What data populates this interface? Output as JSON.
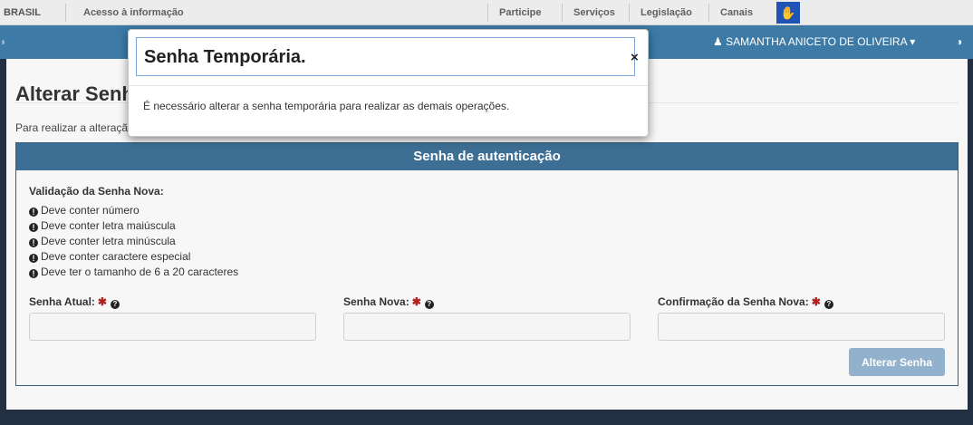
{
  "gov_bar": {
    "brand": "BRASIL",
    "access_info": "Acesso à informação",
    "links": [
      "Participe",
      "Serviços",
      "Legislação",
      "Canais"
    ]
  },
  "navbar": {
    "user_name": "SAMANTHA ANICETO DE OLIVEIRA",
    "icons": [
      "user-icon",
      "caret-down-icon",
      "contrast-icon",
      "accessibility-icon"
    ]
  },
  "page": {
    "title": "Alterar Senha",
    "intro": "Para realizar a alteração"
  },
  "panel": {
    "heading": "Senha de autenticação",
    "rules_title": "Validação da Senha Nova:",
    "rules": [
      "Deve conter número",
      "Deve conter letra maiúscula",
      "Deve conter letra minúscula",
      "Deve conter caractere especial",
      "Deve ter o tamanho de 6 a 20 caracteres"
    ],
    "fields": [
      {
        "label": "Senha Atual:",
        "value": ""
      },
      {
        "label": "Senha Nova:",
        "value": ""
      },
      {
        "label": "Confirmação da Senha Nova:",
        "value": ""
      }
    ],
    "submit_label": "Alterar Senha"
  },
  "modal": {
    "title": "Senha Temporária.",
    "close": "×",
    "body": "É necessário alterar a senha temporária para realizar as demais operações."
  },
  "colors": {
    "navbar": "#3d7aa5",
    "panel_header": "#3d6f94",
    "submit_disabled": "#91b1cc",
    "required": "#b22222"
  }
}
